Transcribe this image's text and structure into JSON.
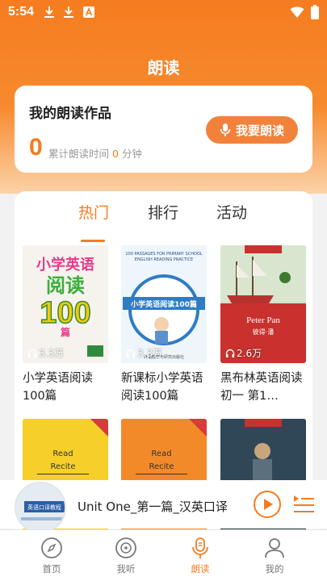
{
  "status": {
    "time": "5:54",
    "icons": [
      "download-icon",
      "download-icon",
      "font-icon",
      "wifi-icon",
      "battery-icon"
    ]
  },
  "header": {
    "title": "朗读"
  },
  "works": {
    "title": "我的朗读作品",
    "button_label": "我要朗读",
    "count": "0",
    "time_prefix": "累计朗读时间",
    "time_value": "0",
    "time_unit": "分钟"
  },
  "tabs": [
    {
      "label": "热门",
      "active": true
    },
    {
      "label": "排行",
      "active": false
    },
    {
      "label": "活动",
      "active": false
    }
  ],
  "books": [
    {
      "title": "小学英语阅读100篇",
      "cover_text": "小学英语阅读100篇",
      "plays": "3.3万"
    },
    {
      "title": "新课标小学英语阅读100篇",
      "cover_text": "100 PASSAGES FOR PRIMARY SCHOOL ENGLISH READING PRACTICE",
      "cover_sub": "小学英语阅读100篇",
      "plays": "3.3万"
    },
    {
      "title": "黑布林英语阅读 初一 第1…",
      "cover_text": "Peter Pan",
      "cover_sub": "彼得·潘",
      "plays": "2.6万"
    },
    {
      "title": "",
      "cover_text": "Read Recite",
      "plays": ""
    },
    {
      "title": "",
      "cover_text": "Read Recite",
      "plays": ""
    },
    {
      "title": "",
      "cover_text": "",
      "plays": ""
    }
  ],
  "player": {
    "title": "Unit One_第一篇_汉英口译",
    "disc_text": "英语口译教程"
  },
  "nav": [
    {
      "label": "首页",
      "icon": "compass-icon",
      "active": false
    },
    {
      "label": "我听",
      "icon": "vinyl-icon",
      "active": false
    },
    {
      "label": "朗读",
      "icon": "microphone-icon",
      "active": true
    },
    {
      "label": "我的",
      "icon": "user-icon",
      "active": false
    }
  ],
  "colors": {
    "accent": "#f57c1f",
    "button": "#f2823a"
  }
}
